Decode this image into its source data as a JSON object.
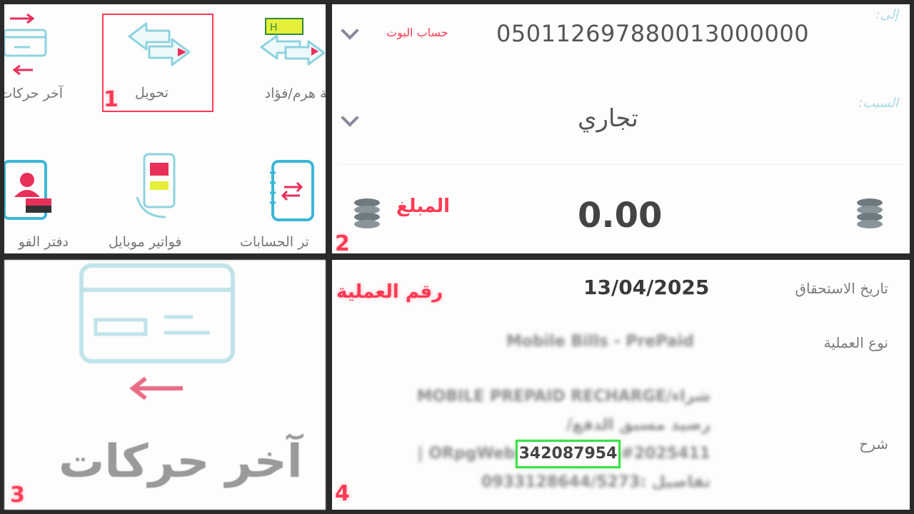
{
  "panel1": {
    "number": "1",
    "items": [
      {
        "label": "آخر حركات"
      },
      {
        "label": "تحويل"
      },
      {
        "label": "لة هرم/فؤاد"
      },
      {
        "label": "دفتر الفو"
      },
      {
        "label": "فواتير موبايل"
      },
      {
        "label": "تر الحسابات"
      }
    ]
  },
  "panel2": {
    "number": "2",
    "to_hint": "إلى:",
    "account_annotation": "حساب البوت",
    "account_number": "050112697880013000000",
    "reason_hint": "السبب:",
    "reason_value": "تجاري",
    "amount_annotation": "المبلغ",
    "amount_value": "0.00"
  },
  "panel3": {
    "number": "3",
    "label": "آخر حركات"
  },
  "panel4": {
    "number": "4",
    "annotation": "رقم العملية",
    "due_date_label": "تاريخ الاستحقاق",
    "due_date_value": "13/04/2025",
    "op_type_label": "نوع العملية",
    "op_type_value": "Mobile Bills - PrePaid",
    "desc_label": "شرح",
    "desc_line1": "MOBILE PREPAID RECHARGE/شراء",
    "desc_line2": "رصيد مسبق الدفع/",
    "desc_line3_prefix": "| ORpgWeb",
    "desc_transaction_id": "342087954",
    "desc_line3_suffix": "#2025411",
    "desc_line4": "0933128644/5273: تفاصيل"
  },
  "colors": {
    "annotation_red": "#ff3a55",
    "highlight_green": "#3ee04a",
    "icon_teal": "#8fd3df",
    "accent_pink": "#e8305a"
  }
}
